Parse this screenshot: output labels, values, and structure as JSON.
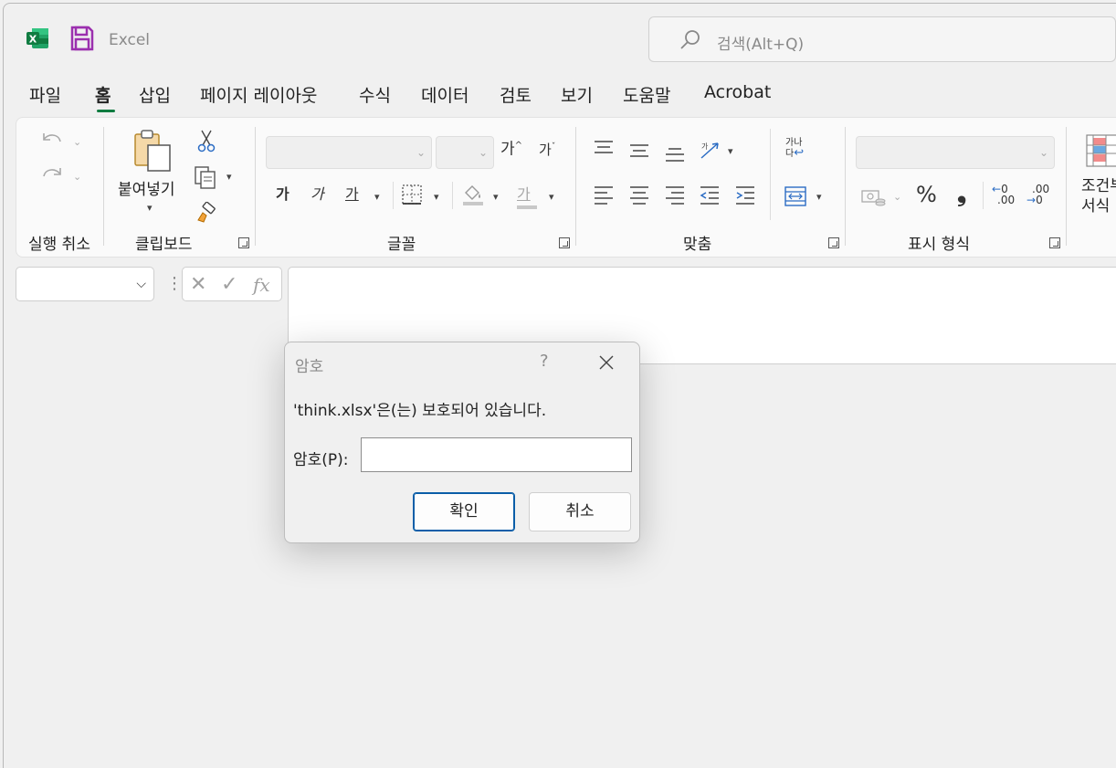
{
  "app": {
    "title": "Excel",
    "search_placeholder": "검색(Alt+Q)",
    "brand_color": "#107c41"
  },
  "tabs": [
    {
      "label": "파일"
    },
    {
      "label": "홈",
      "active": true
    },
    {
      "label": "삽입"
    },
    {
      "label": "페이지 레이아웃"
    },
    {
      "label": "수식"
    },
    {
      "label": "데이터"
    },
    {
      "label": "검토"
    },
    {
      "label": "보기"
    },
    {
      "label": "도움말"
    },
    {
      "label": "Acrobat"
    }
  ],
  "ribbon": {
    "groups": {
      "undo": "실행 취소",
      "clipboard": "클립보드",
      "font": "글꼴",
      "alignment": "맞춤",
      "number": "표시 형식"
    },
    "paste_label": "붙여넣기",
    "font_increase": "가",
    "font_decrease": "가",
    "bold": "가",
    "italic": "가",
    "underline": "가",
    "font_color_glyph": "가",
    "wrap_text_top": "가나",
    "wrap_text_bottom": "다",
    "percent": "%",
    "comma": "❟",
    "increase_decimal_top": "0",
    "increase_decimal_bottom": ".00",
    "decrease_decimal_top": ".00",
    "decrease_decimal_bottom": "0",
    "conditional_format_line1": "조건부",
    "conditional_format_line2": "서식"
  },
  "formula_bar": {
    "fx": "fx"
  },
  "dialog": {
    "title": "암호",
    "help": "?",
    "message": "'think.xlsx'은(는) 보호되어 있습니다.",
    "password_label": "암호(P):",
    "password_value": "",
    "ok_label": "확인",
    "cancel_label": "취소"
  }
}
